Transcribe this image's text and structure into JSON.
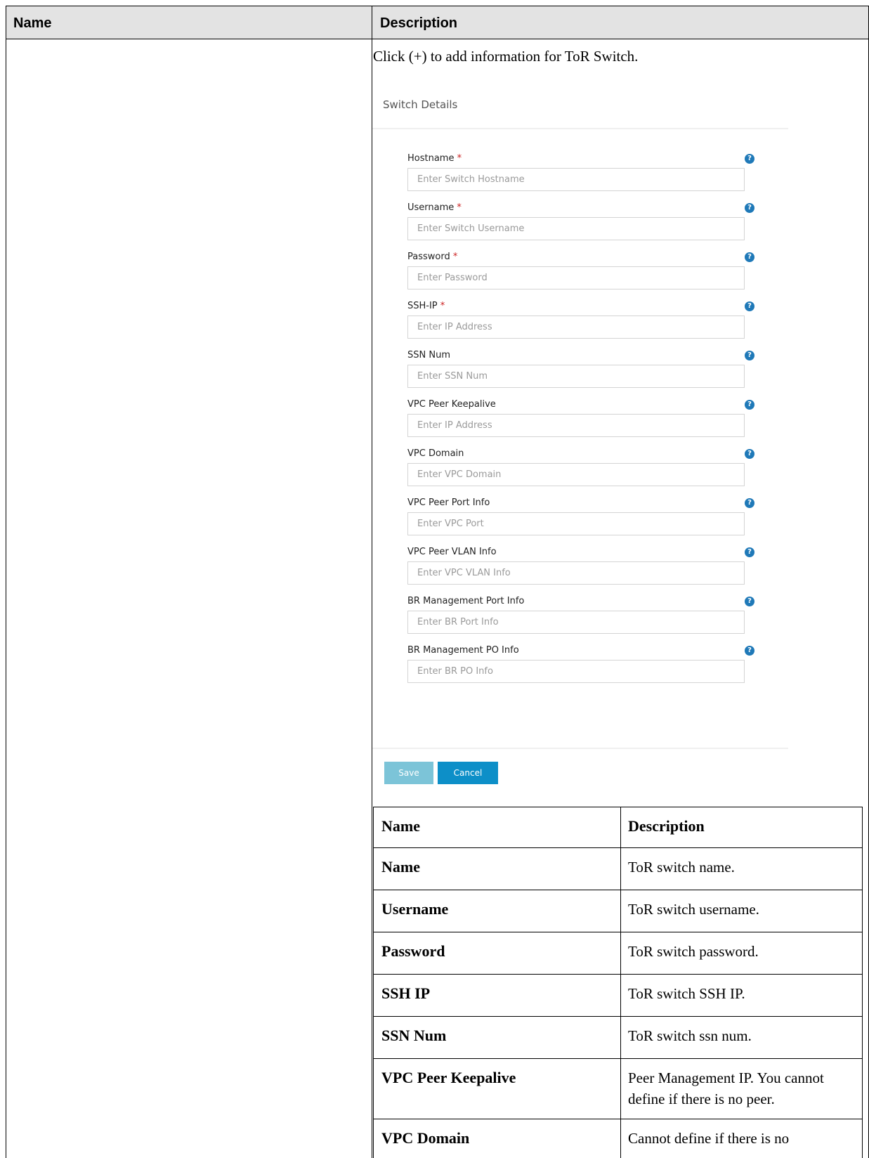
{
  "outer_table": {
    "headers": [
      "Name",
      "Description"
    ]
  },
  "intro": "Click (+) to add information for ToR Switch.",
  "form": {
    "title": "Switch Details",
    "fields": [
      {
        "label": "Hostname",
        "required": true,
        "placeholder": "Enter Switch Hostname"
      },
      {
        "label": "Username",
        "required": true,
        "placeholder": "Enter Switch Username"
      },
      {
        "label": "Password",
        "required": true,
        "placeholder": "Enter Password"
      },
      {
        "label": "SSH-IP",
        "required": true,
        "placeholder": "Enter IP Address"
      },
      {
        "label": "SSN Num",
        "required": false,
        "placeholder": "Enter SSN Num"
      },
      {
        "label": "VPC Peer Keepalive",
        "required": false,
        "placeholder": "Enter IP Address"
      },
      {
        "label": "VPC Domain",
        "required": false,
        "placeholder": "Enter VPC Domain"
      },
      {
        "label": "VPC Peer Port Info",
        "required": false,
        "placeholder": "Enter VPC Port"
      },
      {
        "label": "VPC Peer VLAN Info",
        "required": false,
        "placeholder": "Enter VPC VLAN Info"
      },
      {
        "label": "BR Management Port Info",
        "required": false,
        "placeholder": "Enter BR Port Info"
      },
      {
        "label": "BR Management PO Info",
        "required": false,
        "placeholder": "Enter BR PO Info"
      }
    ],
    "required_marker": "*",
    "help_icon": "question-circle-icon",
    "help_glyph": "?",
    "save_label": "Save",
    "cancel_label": "Cancel"
  },
  "inner_table": {
    "headers": [
      "Name",
      "Description"
    ],
    "rows": [
      {
        "name": "Name",
        "description": "ToR switch name."
      },
      {
        "name": "Username",
        "description": "ToR switch username."
      },
      {
        "name": "Password",
        "description": "ToR switch password."
      },
      {
        "name": "SSH IP",
        "description": "ToR switch SSH IP."
      },
      {
        "name": "SSN Num",
        "description": "ToR switch ssn num."
      },
      {
        "name": "VPC Peer Keepalive",
        "description": "Peer Management IP. You cannot define if there is no peer."
      },
      {
        "name": "VPC Domain",
        "description": "Cannot define if there is no"
      }
    ]
  },
  "colors": {
    "header_bg": "#e3e3e3",
    "help_icon": "#1f79b8",
    "save_button": "#7cc4d8",
    "cancel_button": "#0d8fc8",
    "required_marker": "#cc2222"
  }
}
